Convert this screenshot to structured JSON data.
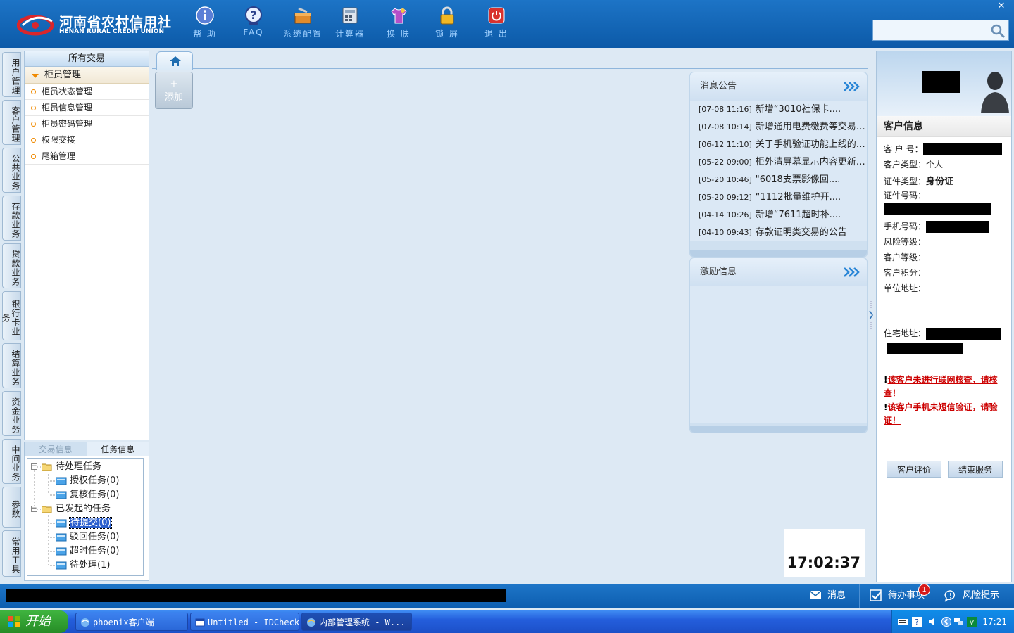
{
  "brand": {
    "name_cn": "河南省农村信用社",
    "name_en": "HENAN RURAL CREDIT UNION"
  },
  "toolbar": [
    {
      "label": "帮 助",
      "icon": "info-icon"
    },
    {
      "label": "FAQ",
      "icon": "question-icon"
    },
    {
      "label": "系统配置",
      "icon": "toolbox-icon"
    },
    {
      "label": "计算器",
      "icon": "calculator-icon"
    },
    {
      "label": "换 肤",
      "icon": "shirt-icon"
    },
    {
      "label": "锁 屏",
      "icon": "lock-icon"
    },
    {
      "label": "退 出",
      "icon": "power-icon"
    }
  ],
  "window_controls": {
    "minimize": "—",
    "close": "✕"
  },
  "search": {
    "value": "",
    "placeholder": ""
  },
  "vertical_tabs": [
    "用户管理",
    "客户管理",
    "公共业务",
    "存款业务",
    "贷款业务",
    "银行卡业务",
    "结算业务",
    "资金业务",
    "中间业务",
    "参数",
    "常用工具"
  ],
  "left_panel": {
    "header": "所有交易",
    "group": "柜员管理",
    "items": [
      "柜员状态管理",
      "柜员信息管理",
      "柜员密码管理",
      "权限交接",
      "尾箱管理"
    ]
  },
  "task_panel": {
    "tabs": [
      "交易信息",
      "任务信息"
    ],
    "tree": {
      "pending": {
        "label": "待处理任务",
        "children": [
          "授权任务(0)",
          "复核任务(0)"
        ]
      },
      "initiated": {
        "label": "已发起的任务",
        "children": [
          "待提交(0)",
          "驳回任务(0)",
          "超时任务(0)",
          "待处理(1)"
        ]
      }
    }
  },
  "main": {
    "add_button": {
      "plus": "+",
      "label": "添加"
    },
    "notices": {
      "title": "消息公告",
      "items": [
        {
          "time": "[07-08 11:16]",
          "text": "新增“3010社保卡...."
        },
        {
          "time": "[07-08 10:14]",
          "text": "新增通用电费缴费等交易的公告"
        },
        {
          "time": "[06-12 11:10]",
          "text": "关于手机验证功能上线的公告"
        },
        {
          "time": "[05-22 09:00]",
          "text": "柜外清屏幕显示内容更新的公告"
        },
        {
          "time": "[05-20 10:46]",
          "text": "\"6018支票影像回...."
        },
        {
          "time": "[05-20 09:12]",
          "text": "“1112批量维护开...."
        },
        {
          "time": "[04-14 10:26]",
          "text": "新增“7611超时补...."
        },
        {
          "time": "[04-10 09:43]",
          "text": "存款证明类交易的公告"
        }
      ]
    },
    "incentive": {
      "title": "激励信息"
    },
    "clock": "17:02:37"
  },
  "customer": {
    "title": "客户信息",
    "fields": {
      "customer_no": "客 户 号：",
      "customer_type_label": "客户类型：",
      "customer_type_value": "个人",
      "id_type_label": "证件类型：",
      "id_type_value": "身份证",
      "id_no": "证件号码：",
      "mobile": "手机号码：",
      "risk_level": "风险等级：",
      "customer_level": "客户等级：",
      "points": "客户积分：",
      "work_address": "单位地址：",
      "home_address": "住宅地址："
    },
    "warnings": [
      {
        "mark": "!",
        "text": "该客户未进行联网核查，请核查！"
      },
      {
        "mark": "!",
        "text": "该客户手机未短信验证，请验证！"
      }
    ],
    "buttons": {
      "evaluate": "客户评价",
      "end": "结束服务"
    }
  },
  "statusbar": {
    "message": "消息",
    "todo": "待办事项",
    "todo_count": "1",
    "risk": "风险提示"
  },
  "taskbar": {
    "start": "开始",
    "tasks": [
      "phoenix客户端",
      "Untitled - IDCheck",
      "内部管理系统 - W..."
    ],
    "time": "17:21"
  }
}
